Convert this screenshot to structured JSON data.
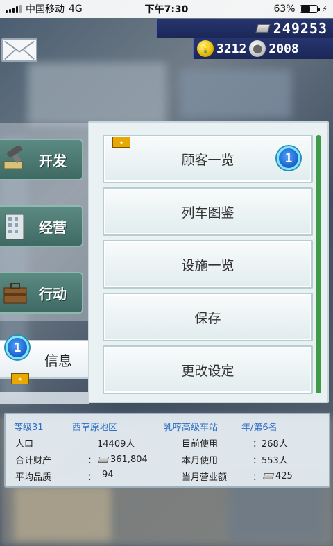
{
  "status_bar": {
    "carrier": "中国移动",
    "network": "4G",
    "time": "下午7:30",
    "battery": "63%",
    "battery_level": 0.63
  },
  "resources": {
    "money": "249253",
    "gold": "3212",
    "silver": "2008"
  },
  "left_menu": {
    "develop": "开发",
    "manage": "经营",
    "action": "行动",
    "info": "信息",
    "info_badge": "1"
  },
  "submenu": {
    "items": [
      {
        "label": "顾客一览",
        "badge": "1"
      },
      {
        "label": "列车图鉴"
      },
      {
        "label": "设施一览"
      },
      {
        "label": "保存"
      },
      {
        "label": "更改设定"
      }
    ]
  },
  "stats": {
    "level": "等级31",
    "region": "西草原地区",
    "station": "乳哼高级车站",
    "rank": "年/第6名",
    "population_label": "人口",
    "population_value": "14409人",
    "assets_label": "合计财产",
    "assets_sep": "：",
    "assets_value": "361,804",
    "quality_label": "平均品质",
    "quality_sep": "：",
    "quality_value": "94",
    "current_usage_label": "目前使用",
    "current_usage_value": "：268人",
    "monthly_usage_label": "本月使用",
    "monthly_usage_value": "：553人",
    "monthly_revenue_label": "当月营业额",
    "monthly_revenue_sep": "：",
    "monthly_revenue_value": "425"
  }
}
